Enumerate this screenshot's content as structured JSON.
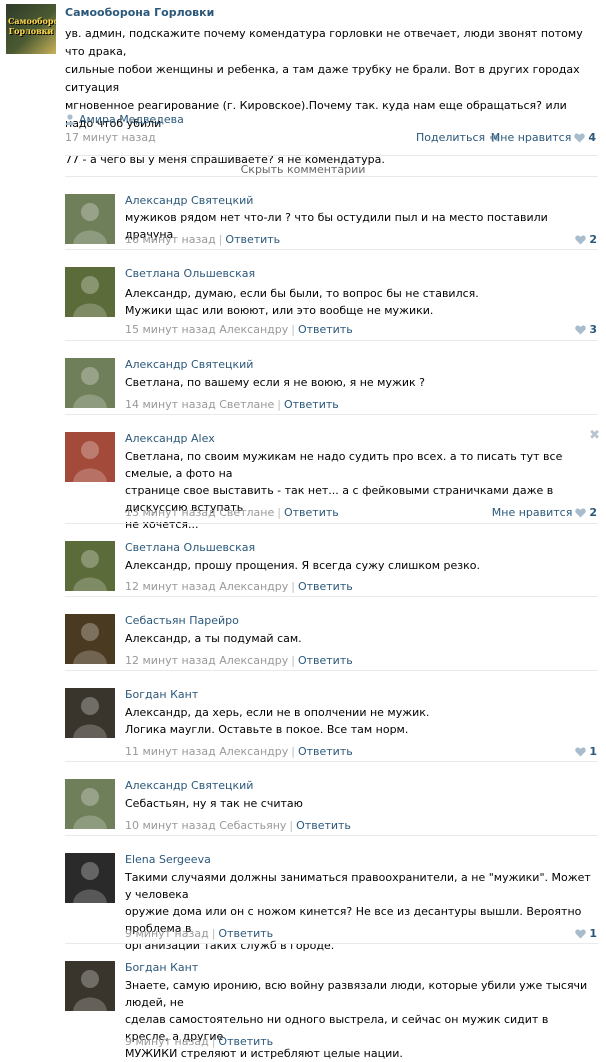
{
  "post": {
    "group_name": "Самооборона Горловки",
    "avatar_text": "Самооборона Горловки",
    "text": "ув. админ, подскажите почему комендатура горловки не отвечает, люди звонят потому что драка,\nсильные побои женщины и ребенка, а там даже трубку не брали. Вот в других городах ситуация\nмгновенное реагирование (г. Кировское).Почему так. куда нам еще обращаться? или надо чтоб убили\n\n77 - а чего вы у меня спрашиваете? я не комендатура.",
    "author": "Амира Медведева",
    "author_icon": "user-icon",
    "time": "17 минут назад",
    "share_label": "Поделиться",
    "share_icon": "megaphone-icon",
    "like_label": "Мне нравится",
    "like_count": "4",
    "hide_comments_label": "Скрыть комментарии"
  },
  "comments": [
    {
      "author": "Александр Святецкий",
      "text": "мужиков рядом нет что-ли ? что бы остудили пыл и на место поставили драчуна",
      "time": "16 минут назад",
      "reply_to": "",
      "reply_label": "Ответить",
      "likes": "2",
      "like_label": "",
      "avatar_color": "#6f7f5a"
    },
    {
      "author": "Светлана Ольшевская",
      "text": "Александр, думаю, если бы были, то вопрос бы не ставился.\nМужики щас или воюют, или это вообще не мужики.",
      "time": "15 минут назад",
      "reply_to": "Александру",
      "reply_label": "Ответить",
      "likes": "3",
      "like_label": "",
      "avatar_color": "#5c6b3a"
    },
    {
      "author": "Александр Святецкий",
      "text": "Светлана, по вашему если я не воюю, я не мужик ?",
      "time": "14 минут назад",
      "reply_to": "Светлане",
      "reply_label": "Ответить",
      "likes": "",
      "like_label": "",
      "avatar_color": "#6f7f5a"
    },
    {
      "author": "Александр Alex",
      "text": "Светлана, по своим мужикам не надо судить про всех. а то писать тут все смелые, а фото на\nстранице свое выставить - так нет... а с фейковыми страничками даже в дискуссию вступать\nне хочется...",
      "time": "13 минут назад",
      "reply_to": "Светлане",
      "reply_label": "Ответить",
      "likes": "2",
      "like_label": "Мне нравится",
      "avatar_color": "#a34a3a"
    },
    {
      "author": "Светлана Ольшевская",
      "text": "Александр, прошу прощения. Я всегда сужу слишком резко.",
      "time": "12 минут назад",
      "reply_to": "Александру",
      "reply_label": "Ответить",
      "likes": "",
      "like_label": "",
      "avatar_color": "#5c6b3a"
    },
    {
      "author": "Себастьян Парейро",
      "text": "Александр, а ты подумай сам.",
      "time": "12 минут назад",
      "reply_to": "Александру",
      "reply_label": "Ответить",
      "likes": "",
      "like_label": "",
      "avatar_color": "#4a3a22"
    },
    {
      "author": "Богдан Кант",
      "text": "Александр, да херь, если не в ополчении не мужик.\nЛогика маугли. Оставьте в покое. Все там норм.",
      "time": "11 минут назад",
      "reply_to": "Александру",
      "reply_label": "Ответить",
      "likes": "1",
      "like_label": "",
      "avatar_color": "#3a352c"
    },
    {
      "author": "Александр Святецкий",
      "text": "Себастьян, ну я так не считаю",
      "time": "10 минут назад",
      "reply_to": "Себастьяну",
      "reply_label": "Ответить",
      "likes": "",
      "like_label": "",
      "avatar_color": "#6f7f5a"
    },
    {
      "author": "Elena Sergeeva",
      "text": "Такими случаями должны заниматься правоохранители, а не \"мужики\". Может у человека\nоружие дома или он с ножом кинется? Не все из десантуры вышли. Вероятно проблема в\nорганизации таких служб в городе.",
      "time": "9 минут назад",
      "reply_to": "",
      "reply_label": "Ответить",
      "likes": "1",
      "like_label": "",
      "avatar_color": "#2a2a2a"
    },
    {
      "author": "Богдан Кант",
      "text": "Знаете, самую иронию, всю войну развязали люди, которые убили уже тысячи людей, не\nсделав самостоятельно ни одного выстрела, и сейчас он мужик сидит в кресле, а другие\nМУЖИКИ стреляют и истребляют целые нации.",
      "time": "9 минут назад",
      "reply_to": "",
      "reply_label": "Ответить",
      "likes": "",
      "like_label": "",
      "avatar_color": "#3a352c"
    }
  ],
  "colors": {
    "link": "#2b587a",
    "muted": "#999999",
    "heart": "#a8bccd",
    "divider": "#e7eaed"
  }
}
